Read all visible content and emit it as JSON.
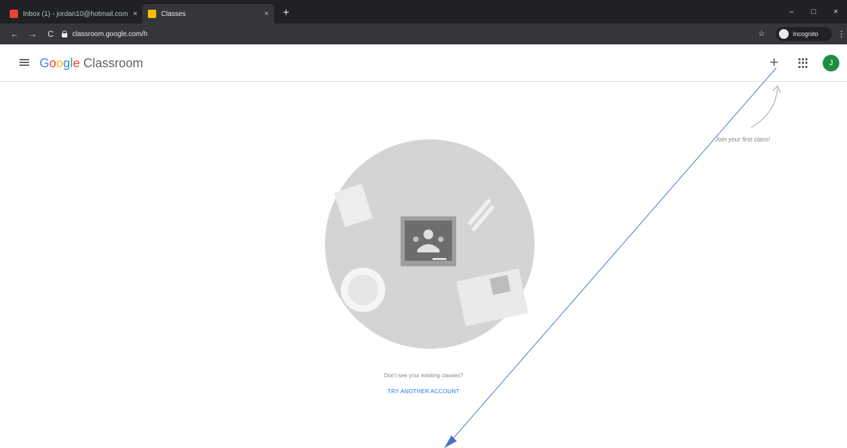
{
  "browser": {
    "tabs": [
      {
        "title": "Inbox (1) - jordan10@hotmail.com",
        "favicon_color": "#ea4335",
        "active": false
      },
      {
        "title": "Classes",
        "favicon_color": "#fbbc04",
        "active": true
      }
    ],
    "new_tab_glyph": "+",
    "tab_close_glyph": "×",
    "window_controls": {
      "minimize": "–",
      "maximize": "□",
      "close": "×"
    },
    "nav": {
      "back": "←",
      "forward": "→",
      "reload": "C"
    },
    "url": "classroom.google.com/h",
    "incognito_label": "Incognito",
    "star_glyph": "☆",
    "kebab_glyph": "⋮"
  },
  "app": {
    "logo": {
      "g": "G",
      "o1": "o",
      "o2": "o",
      "g2": "g",
      "l": "l",
      "e": "e",
      "product": " Classroom"
    },
    "add_glyph": "+",
    "avatar_initial": "J",
    "hint": "Join your first class!",
    "empty_state": {
      "message": "Don't see your existing classes?",
      "link": "TRY ANOTHER ACCOUNT"
    }
  },
  "icons": [
    "menu-icon",
    "add-icon",
    "apps-grid-icon",
    "lock-icon",
    "star-icon",
    "incognito-icon",
    "kebab-icon"
  ],
  "colors": {
    "chrome_dark": "#202124",
    "chrome_toolbar": "#35363a",
    "link_blue": "#1a73e8",
    "avatar_green": "#1e8e3e",
    "annotation_blue": "#4472c4"
  }
}
